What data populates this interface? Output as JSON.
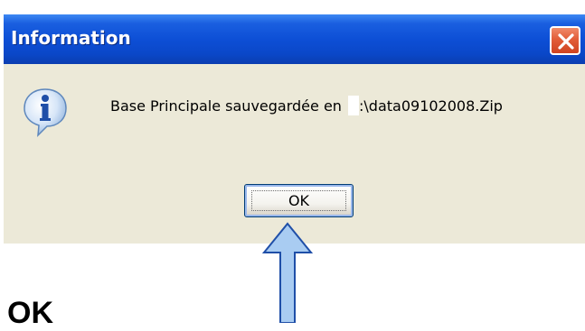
{
  "dialog": {
    "title": "Information",
    "message": "Base Principale sauvegardée en ",
    "message_path": ":\\data09102008.Zip",
    "ok_label": "OK",
    "icon": "info-icon",
    "close_icon": "close-icon"
  },
  "annotation": {
    "arrow_icon": "up-arrow-icon",
    "arrow_color": "#a9ccf2",
    "text": "OK"
  },
  "colors": {
    "titlebar": "#0a47c8",
    "dialog_bg": "#ece9d8",
    "close_button": "#e25d38"
  }
}
